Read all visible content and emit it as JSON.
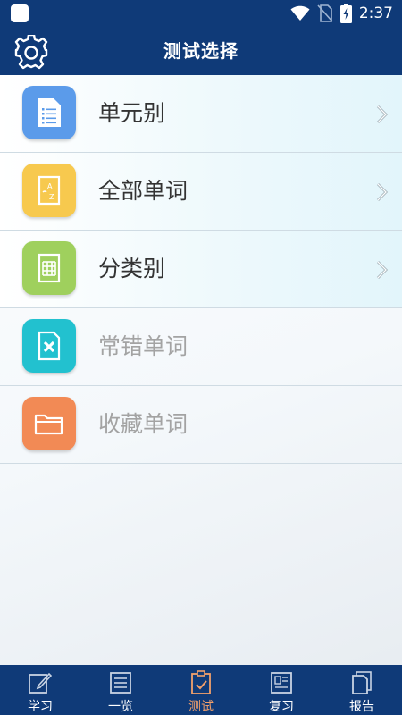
{
  "status_bar": {
    "time": "2:37",
    "icons": [
      "wifi-icon",
      "no-sim-icon",
      "battery-charging-icon"
    ]
  },
  "header": {
    "title": "测试选择",
    "settings_icon": "gear-icon"
  },
  "menu": {
    "items": [
      {
        "label": "单元别",
        "icon": "document-list-icon",
        "icon_color": "#5b9bea",
        "enabled": true
      },
      {
        "label": "全部单词",
        "icon": "az-card-icon",
        "icon_color": "#f7c94e",
        "enabled": true
      },
      {
        "label": "分类别",
        "icon": "grid-sheet-icon",
        "icon_color": "#9fd05d",
        "enabled": true
      },
      {
        "label": "常错单词",
        "icon": "error-doc-icon",
        "icon_color": "#22c1cf",
        "enabled": false
      },
      {
        "label": "收藏单词",
        "icon": "folder-icon",
        "icon_color": "#f28a55",
        "enabled": false
      }
    ]
  },
  "tabs": {
    "items": [
      {
        "label": "学习",
        "icon": "pencil-note-icon",
        "active": false
      },
      {
        "label": "一览",
        "icon": "list-icon",
        "active": false
      },
      {
        "label": "测试",
        "icon": "clipboard-check-icon",
        "active": true
      },
      {
        "label": "复习",
        "icon": "card-review-icon",
        "active": false
      },
      {
        "label": "报告",
        "icon": "report-docs-icon",
        "active": false
      }
    ]
  },
  "colors": {
    "primary": "#0f3a78",
    "active_tab": "#f2a06b",
    "enabled_text": "#333333",
    "disabled_text": "#a3a3a3"
  }
}
